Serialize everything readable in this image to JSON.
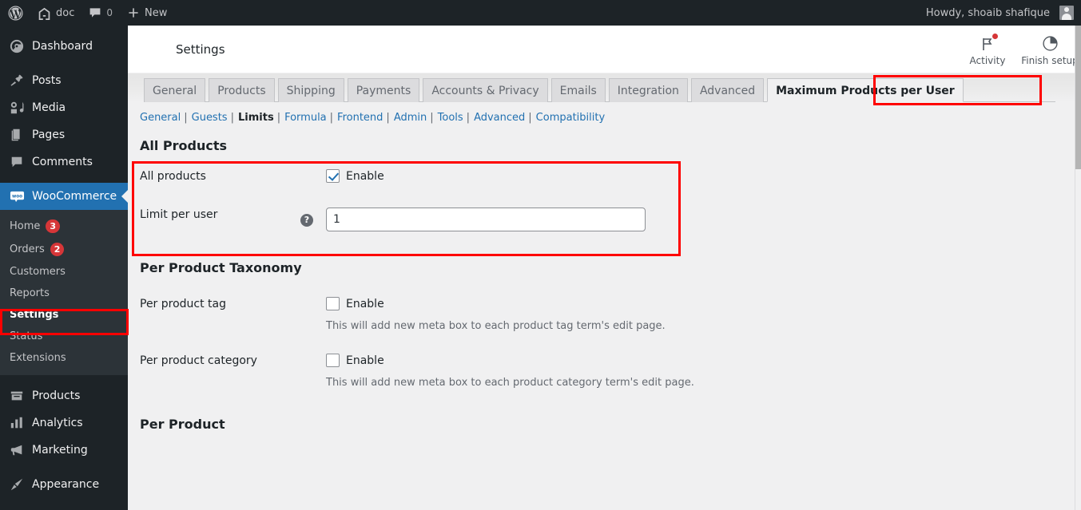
{
  "adminbar": {
    "site_name": "doc",
    "comment_count": "0",
    "new_label": "New",
    "greeting": "Howdy, shoaib shafique"
  },
  "sidebar": {
    "items": [
      {
        "label": "Dashboard",
        "icon": "dashboard-icon",
        "current": false
      },
      {
        "label": "Posts",
        "icon": "pin-icon",
        "current": false
      },
      {
        "label": "Media",
        "icon": "media-icon",
        "current": false
      },
      {
        "label": "Pages",
        "icon": "pages-icon",
        "current": false
      },
      {
        "label": "Comments",
        "icon": "comment-icon",
        "current": false
      },
      {
        "label": "WooCommerce",
        "icon": "woocommerce-icon",
        "current": true
      },
      {
        "label": "Products",
        "icon": "products-icon",
        "current": false
      },
      {
        "label": "Analytics",
        "icon": "analytics-icon",
        "current": false
      },
      {
        "label": "Marketing",
        "icon": "megaphone-icon",
        "current": false
      },
      {
        "label": "Appearance",
        "icon": "brush-icon",
        "current": false
      }
    ],
    "submenu": [
      {
        "label": "Home",
        "badge": "3",
        "current": false
      },
      {
        "label": "Orders",
        "badge": "2",
        "current": false
      },
      {
        "label": "Customers",
        "badge": "",
        "current": false
      },
      {
        "label": "Reports",
        "badge": "",
        "current": false
      },
      {
        "label": "Settings",
        "badge": "",
        "current": true
      },
      {
        "label": "Status",
        "badge": "",
        "current": false
      },
      {
        "label": "Extensions",
        "badge": "",
        "current": false
      }
    ]
  },
  "header": {
    "title": "Settings",
    "actions": [
      {
        "label": "Activity",
        "icon": "flag-icon",
        "has_dot": true
      },
      {
        "label": "Finish setup",
        "icon": "progress-circle-icon",
        "has_dot": false
      }
    ]
  },
  "nav_tabs": [
    {
      "label": "General",
      "active": false
    },
    {
      "label": "Products",
      "active": false
    },
    {
      "label": "Shipping",
      "active": false
    },
    {
      "label": "Payments",
      "active": false
    },
    {
      "label": "Accounts & Privacy",
      "active": false
    },
    {
      "label": "Emails",
      "active": false
    },
    {
      "label": "Integration",
      "active": false
    },
    {
      "label": "Advanced",
      "active": false
    },
    {
      "label": "Maximum Products per User",
      "active": true
    }
  ],
  "subnav": [
    {
      "label": "General",
      "current": false
    },
    {
      "label": "Guests",
      "current": false
    },
    {
      "label": "Limits",
      "current": true
    },
    {
      "label": "Formula",
      "current": false
    },
    {
      "label": "Frontend",
      "current": false
    },
    {
      "label": "Admin",
      "current": false
    },
    {
      "label": "Tools",
      "current": false
    },
    {
      "label": "Advanced",
      "current": false
    },
    {
      "label": "Compatibility",
      "current": false
    }
  ],
  "sections": {
    "all_products": {
      "title": "All Products",
      "row_all_products": {
        "label": "All products",
        "checkbox_label": "Enable",
        "checked": true
      },
      "row_limit": {
        "label": "Limit per user",
        "help_icon": "help-icon",
        "value": "1",
        "placeholder": ""
      }
    },
    "per_product_taxonomy": {
      "title": "Per Product Taxonomy",
      "row_tag": {
        "label": "Per product tag",
        "checkbox_label": "Enable",
        "checked": false,
        "description": "This will add new meta box to each product tag term's edit page."
      },
      "row_category": {
        "label": "Per product category",
        "checkbox_label": "Enable",
        "checked": false,
        "description": "This will add new meta box to each product category term's edit page."
      }
    },
    "per_product": {
      "title": "Per Product"
    }
  },
  "colors": {
    "admin_dark": "#1d2327",
    "submenu_dark": "#2c3338",
    "accent_blue": "#2271b1",
    "badge_red": "#d63638",
    "annotation_red": "#fe0000",
    "content_bg": "#f0f0f1"
  }
}
